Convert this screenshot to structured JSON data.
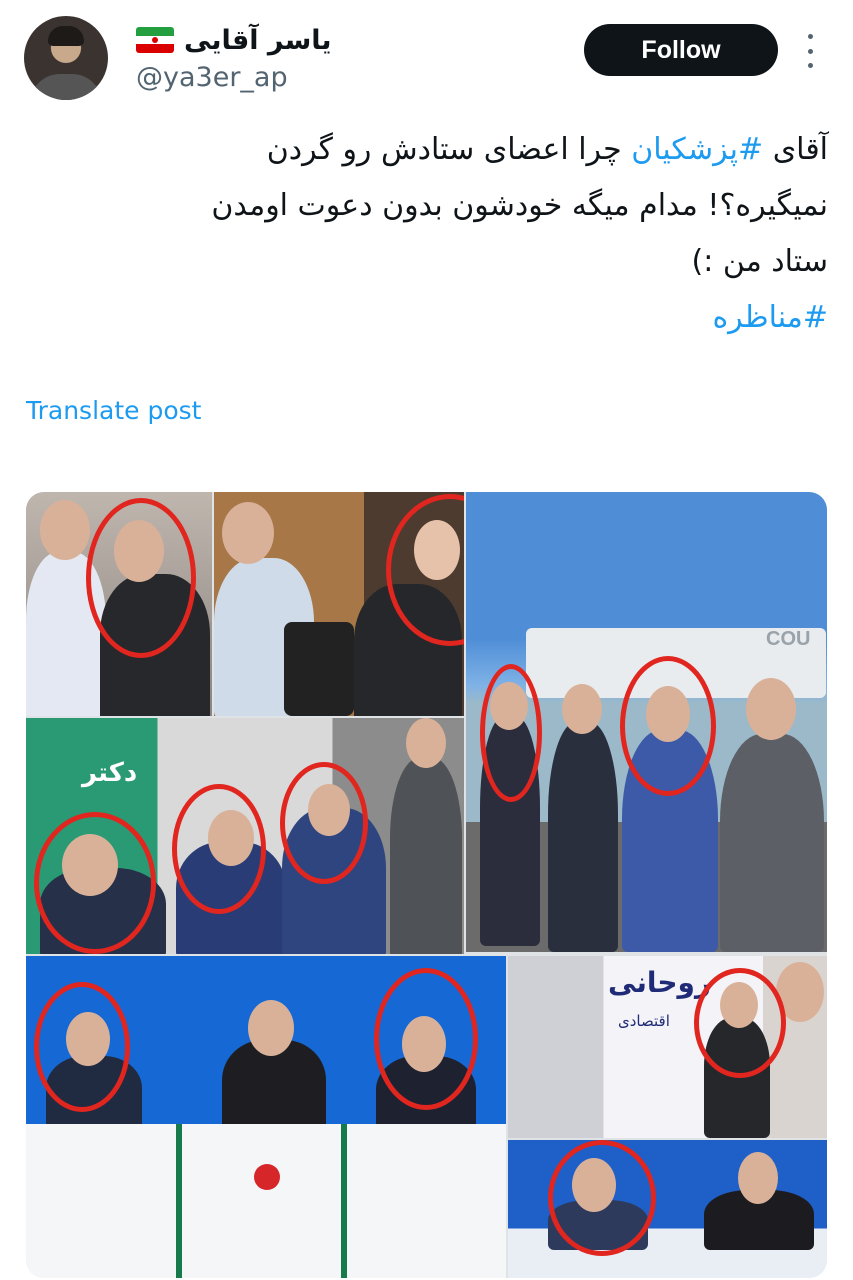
{
  "user": {
    "display_name": "یاسر آقایی",
    "flag": "iran-flag-emoji",
    "handle": "@ya3er_ap"
  },
  "actions": {
    "follow_label": "Follow",
    "more_icon": "more-vertical-icon"
  },
  "tweet": {
    "line1_prefix": "آقای ",
    "line1_hashtag": "#پزشکیان",
    "line1_rest": " چرا اعضای ستادش رو گردن",
    "line2": "نمیگیره؟! مدام میگه خودشون بدون دعوت اومدن",
    "line3": "ستاد من :)",
    "hashtag2": "#مناظره"
  },
  "translate_label": "Translate post",
  "media": {
    "banner_texts": [
      "COU",
      "دکتر",
      "روحانی",
      "اقتصادی"
    ],
    "highlight_color": "#e0261f"
  }
}
